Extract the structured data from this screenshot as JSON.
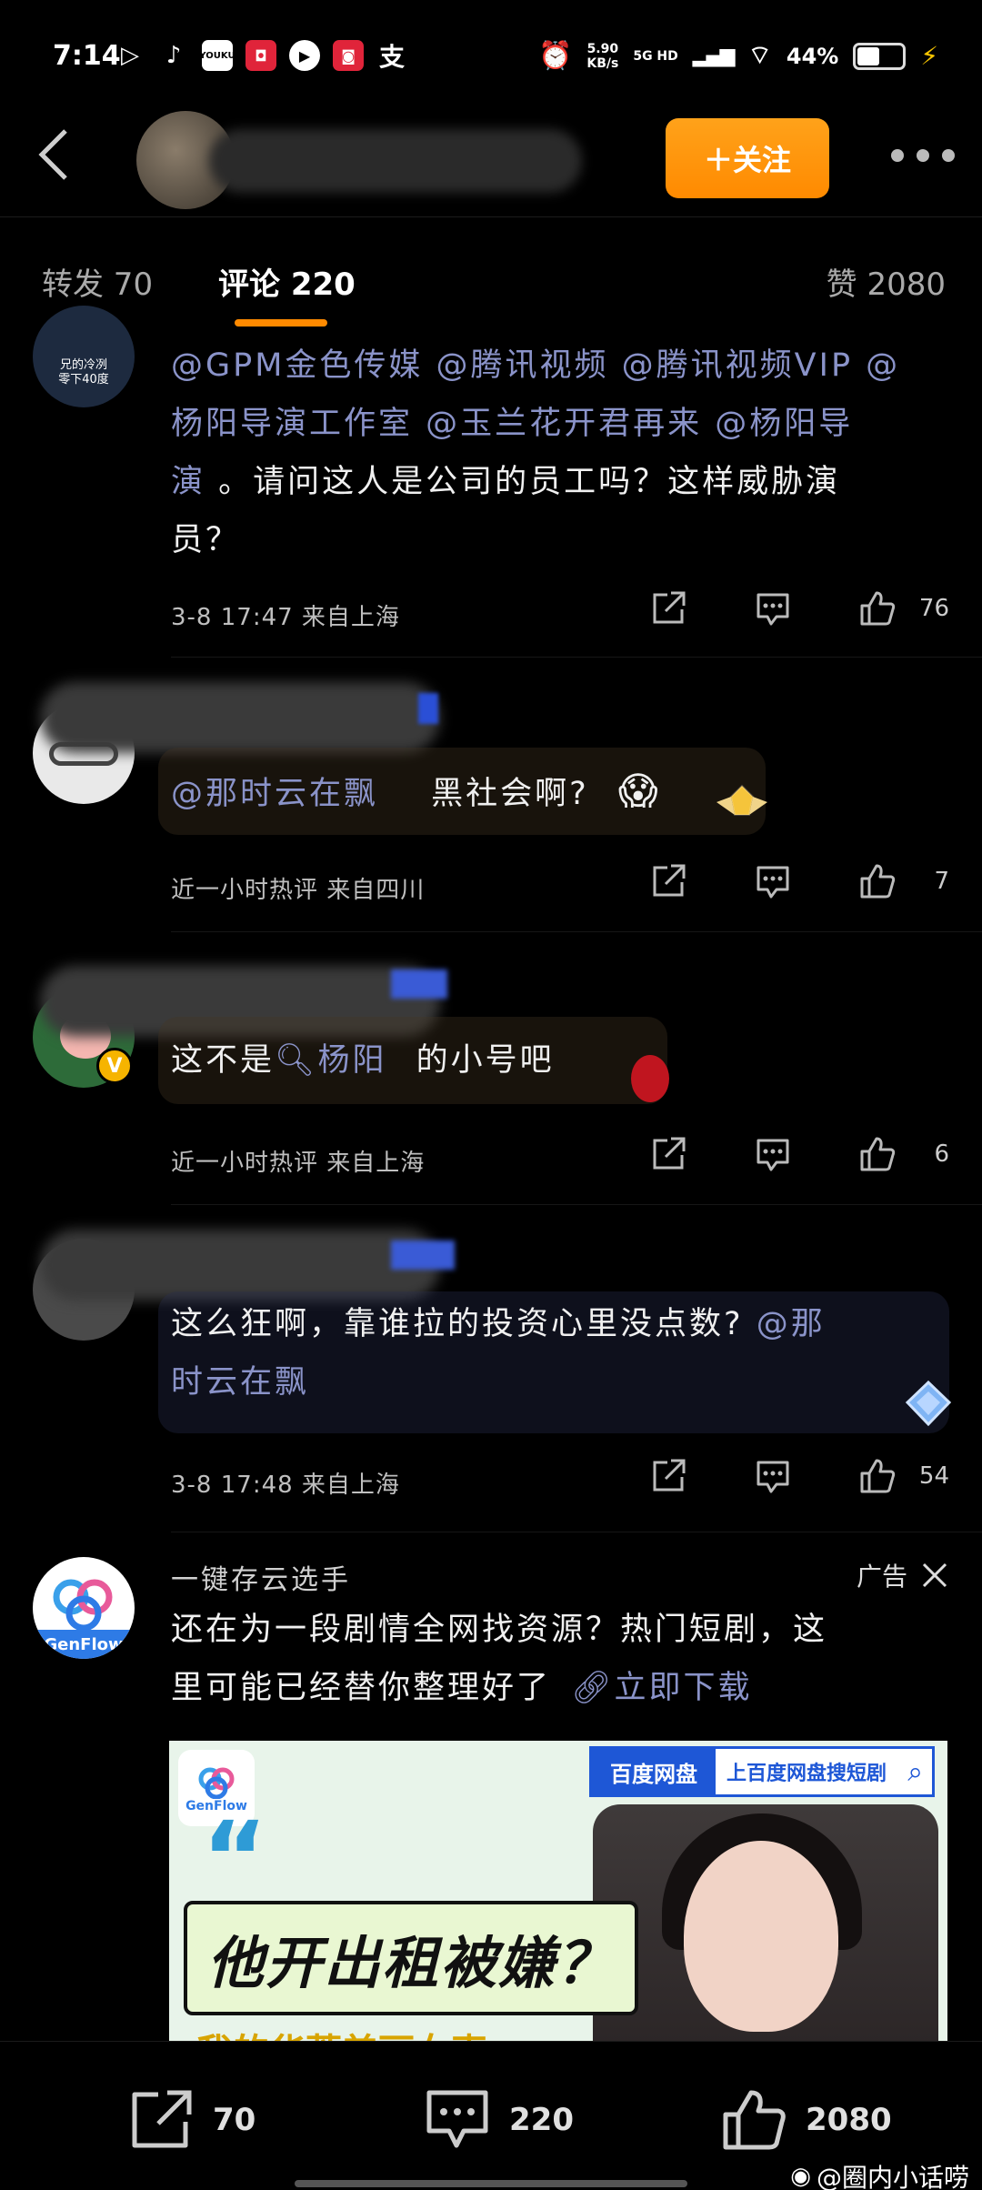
{
  "status_bar": {
    "time": "7:14",
    "app_icons": [
      "play-icon",
      "tiktok-icon",
      "youku-icon",
      "red-app-icon",
      "play-circle-icon",
      "red-app-icon-2",
      "alipay-icon"
    ],
    "net_speed": "5.90",
    "net_unit": "KB/s",
    "network": "5G HD",
    "battery": "44%"
  },
  "header": {
    "follow_label": "＋关注"
  },
  "tabs": {
    "repost": "转发 70",
    "comments": "评论 220",
    "likes": "赞 2080"
  },
  "comments": [
    {
      "avatar_caption_1": "兄的冷冽",
      "avatar_caption_2": "零下40度",
      "mentions_line1": "@GPM金色传媒 @腾讯视频 @腾讯视频VIP @",
      "mentions_line2": "杨阳导演工作室 @玉兰花开君再来 @杨阳导",
      "line3_mention": "演",
      "line3_text": " 。请问这人是公司的员工吗？这样威胁演",
      "line4": "员？",
      "time": "3-8  17:47  来自上海",
      "likes": "76"
    },
    {
      "mention": "@那时云在飘",
      "text": "黑社会啊?",
      "emoji": "😱",
      "time": "近一小时热评  来自四川",
      "likes": "7"
    },
    {
      "prefix": "这不是",
      "search_topic": "杨阳",
      "suffix": "的小号吧",
      "time": "近一小时热评  来自上海",
      "likes": "6"
    },
    {
      "line1_text": "这么狂啊，靠谁拉的投资心里没点数? ",
      "line1_mention": "@那",
      "line2_mention": "时云在飘",
      "time": "3-8  17:48  来自上海",
      "likes": "54"
    }
  ],
  "ad": {
    "advertiser": "一键存云选手",
    "ad_label": "广告",
    "text_line1": "还在为一段剧情全网找资源？热门短剧，这",
    "text_line2": "里可能已经替你整理好了",
    "link_label": "立即下载",
    "logo_text": "GenFlow",
    "banner_brand": "百度网盘",
    "banner_search": "上百度网盘搜短剧",
    "banner_headline": "他开出租被嫌？",
    "banner_subline": "我的华蒂美丽女声"
  },
  "bottom_bar": {
    "repost_count": "70",
    "comment_count": "220",
    "like_count": "2080",
    "watermark": "@圈内小话唠"
  },
  "colors": {
    "accent_orange": "#ff8a00",
    "mention_blue": "#8a93c9"
  }
}
